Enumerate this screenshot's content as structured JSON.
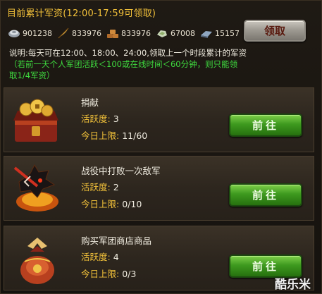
{
  "header": {
    "title": "目前累计军资(12:00-17:59可领取)",
    "claim_label": "领取"
  },
  "resources": [
    {
      "icon": "silver-icon",
      "value": "901238"
    },
    {
      "icon": "feather-icon",
      "value": "833976"
    },
    {
      "icon": "wood-icon",
      "value": "833976"
    },
    {
      "icon": "jade-icon",
      "value": "67008"
    },
    {
      "icon": "iron-icon",
      "value": "15157"
    }
  ],
  "description": {
    "line1": "说明:每天可在12:00、18:00、24:00,领取上一个时段累计的军资",
    "line2": "（若前一天个人军团活跃＜100或在线时间＜60分钟，则只能领",
    "line3": "取1/4军资）"
  },
  "tasks": [
    {
      "name": "捐献",
      "activity_label": "活跃度:",
      "activity_value": "3",
      "limit_label": "今日上限:",
      "limit_value": "11/60",
      "button": "前往",
      "icon": "treasure-chest-icon"
    },
    {
      "name": "战役中打败一次敌军",
      "activity_label": "活跃度:",
      "activity_value": "2",
      "limit_label": "今日上限:",
      "limit_value": "0/10",
      "button": "前往",
      "icon": "wolf-emblem-icon"
    },
    {
      "name": "购买军团商店商品",
      "activity_label": "活跃度:",
      "activity_value": "4",
      "limit_label": "今日上限:",
      "limit_value": "0/3",
      "button": "前往",
      "icon": "gift-bag-icon"
    }
  ],
  "watermark": "酷乐米",
  "colors": {
    "gold": "#f3c23a",
    "green_note": "#3fdc3f",
    "button_green": "#3e9a1f"
  }
}
